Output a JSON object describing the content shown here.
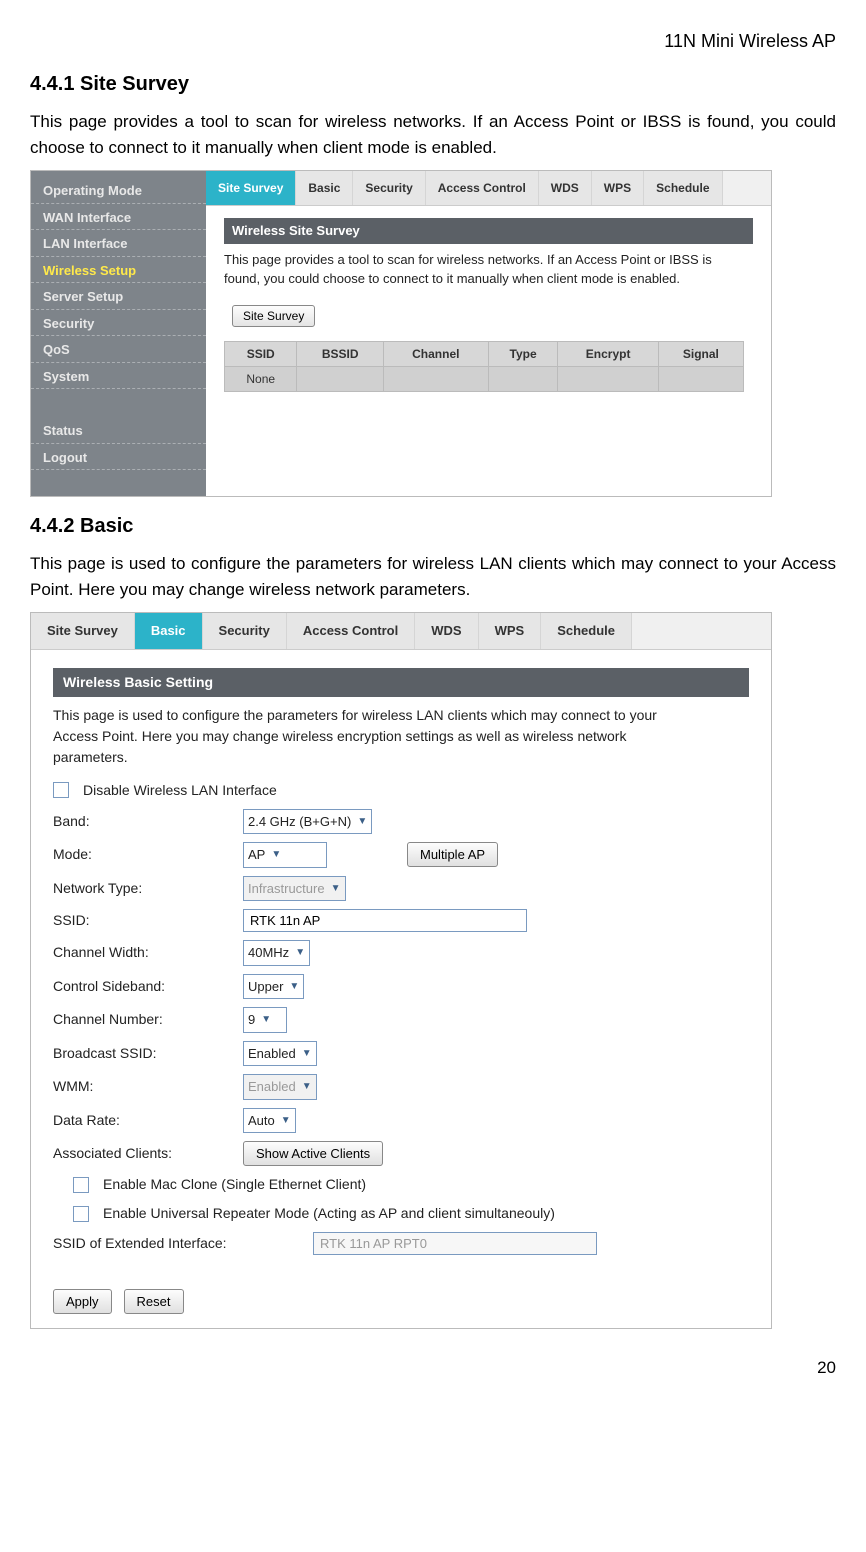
{
  "header_right": "11N Mini Wireless AP",
  "s1": {
    "heading": "4.4.1 Site Survey",
    "text": "This page provides a tool to scan for wireless networks. If an Access Point or IBSS is found, you could choose to connect to it manually when client mode is enabled."
  },
  "sidebar": {
    "items": [
      "Operating Mode",
      "WAN Interface",
      "LAN Interface",
      "Wireless Setup",
      "Server Setup",
      "Security",
      "QoS",
      "System"
    ],
    "items_bottom": [
      "Status",
      "Logout"
    ],
    "active_index": 3
  },
  "tabs1": [
    "Site Survey",
    "Basic",
    "Security",
    "Access Control",
    "WDS",
    "WPS",
    "Schedule"
  ],
  "tabs1_active": 0,
  "panel1": {
    "title": "Wireless Site Survey",
    "desc": "This page provides a tool to scan for wireless networks. If an Access Point or IBSS is found, you could choose to connect to it manually when client mode is enabled.",
    "button": "Site Survey",
    "cols": [
      "SSID",
      "BSSID",
      "Channel",
      "Type",
      "Encrypt",
      "Signal"
    ],
    "row0": "None"
  },
  "s2": {
    "heading": "4.4.2 Basic",
    "text": "This page is used to configure the parameters for wireless LAN clients which may connect to your Access Point. Here you may change wireless network parameters."
  },
  "tabs2": [
    "Site Survey",
    "Basic",
    "Security",
    "Access Control",
    "WDS",
    "WPS",
    "Schedule"
  ],
  "tabs2_active": 1,
  "panel2": {
    "title": "Wireless Basic Setting",
    "desc": "This page is used to configure the parameters for wireless LAN clients which may connect to your Access Point. Here you may change wireless encryption settings as well as wireless network parameters.",
    "cb_disable_label": "Disable Wireless LAN Interface",
    "labels": {
      "band": "Band:",
      "mode": "Mode:",
      "nettype": "Network Type:",
      "ssid": "SSID:",
      "chwidth": "Channel Width:",
      "sideband": "Control Sideband:",
      "chnum": "Channel Number:",
      "bcast": "Broadcast SSID:",
      "wmm": "WMM:",
      "datarate": "Data Rate:",
      "assoc": "Associated Clients:",
      "macclone": "Enable Mac Clone (Single Ethernet Client)",
      "urepeat": "Enable Universal Repeater Mode (Acting as AP and client simultaneouly)",
      "extssid": "SSID of Extended Interface:"
    },
    "values": {
      "band": "2.4 GHz (B+G+N)",
      "mode": "AP",
      "multiple_ap_btn": "Multiple AP",
      "nettype": "Infrastructure",
      "ssid": "RTK 11n AP",
      "chwidth": "40MHz",
      "sideband": "Upper",
      "chnum": "9",
      "bcast": "Enabled",
      "wmm": "Enabled",
      "datarate": "Auto",
      "assocbtn": "Show Active Clients",
      "extssid": "RTK 11n AP RPT0"
    },
    "apply": "Apply",
    "reset": "Reset"
  },
  "page_number": "20"
}
